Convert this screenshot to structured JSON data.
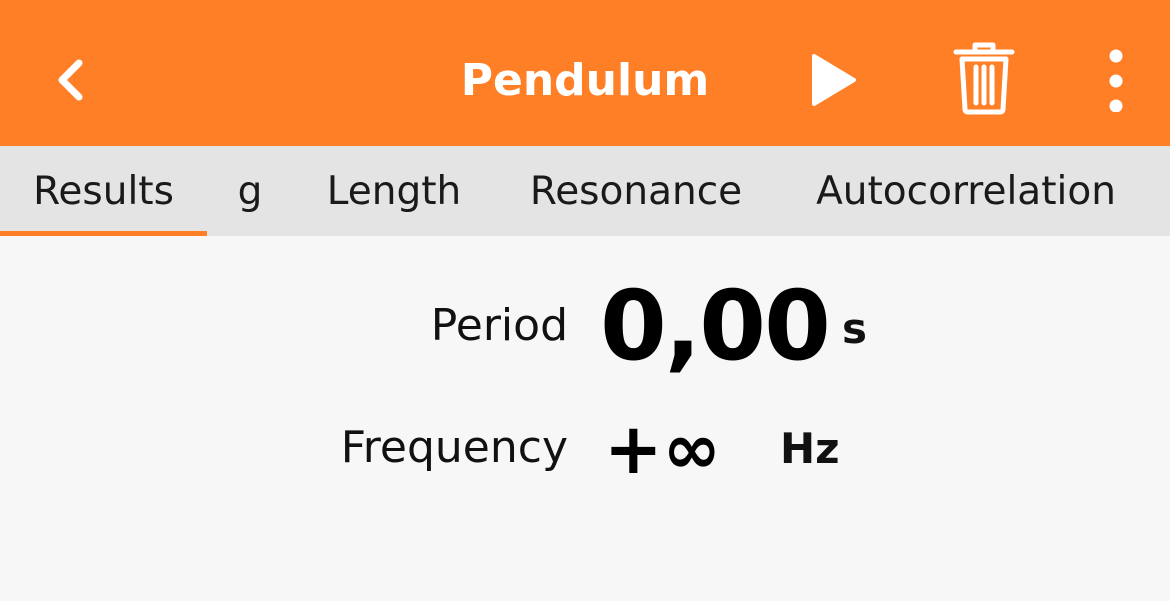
{
  "header": {
    "title": "Pendulum",
    "back_icon": "chevron-left-icon",
    "play_icon": "play-icon",
    "trash_icon": "trash-icon",
    "more_icon": "more-vertical-icon",
    "accent_color": "#ff7f27"
  },
  "tabs": [
    {
      "label": "Results",
      "active": true
    },
    {
      "label": "g",
      "active": false
    },
    {
      "label": "Length",
      "active": false
    },
    {
      "label": "Resonance",
      "active": false
    },
    {
      "label": "Autocorrelation",
      "active": false
    }
  ],
  "results": {
    "period": {
      "label": "Period",
      "value": "0,00",
      "unit": "s"
    },
    "frequency": {
      "label": "Frequency",
      "value": "+∞",
      "unit": "Hz"
    }
  }
}
